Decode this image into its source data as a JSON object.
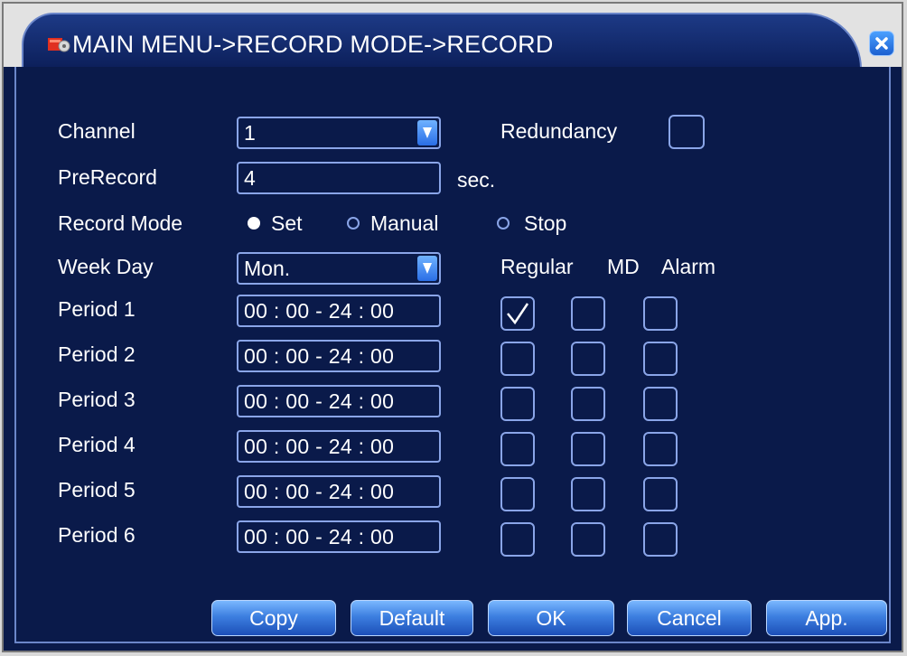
{
  "window": {
    "title": "MAIN MENU->RECORD MODE->RECORD"
  },
  "form": {
    "channel_label": "Channel",
    "channel_value": "1",
    "redundancy_label": "Redundancy",
    "prerecord_label": "PreRecord",
    "prerecord_value": "4",
    "prerecord_unit": "sec.",
    "record_mode_label": "Record Mode",
    "record_mode_options": [
      {
        "label": "Set",
        "selected": true
      },
      {
        "label": "Manual",
        "selected": false
      },
      {
        "label": "Stop",
        "selected": false
      }
    ],
    "weekday_label": "Week Day",
    "weekday_value": "Mon.",
    "columns": [
      "Regular",
      "MD",
      "Alarm"
    ],
    "periods": [
      {
        "label": "Period 1",
        "time": "00 : 00 - 24 : 00",
        "regular": true,
        "md": false,
        "alarm": false
      },
      {
        "label": "Period 2",
        "time": "00 : 00 - 24 : 00",
        "regular": false,
        "md": false,
        "alarm": false
      },
      {
        "label": "Period 3",
        "time": "00 : 00 - 24 : 00",
        "regular": false,
        "md": false,
        "alarm": false
      },
      {
        "label": "Period 4",
        "time": "00 : 00 - 24 : 00",
        "regular": false,
        "md": false,
        "alarm": false
      },
      {
        "label": "Period 5",
        "time": "00 : 00 - 24 : 00",
        "regular": false,
        "md": false,
        "alarm": false
      },
      {
        "label": "Period 6",
        "time": "00 : 00 - 24 : 00",
        "regular": false,
        "md": false,
        "alarm": false
      }
    ]
  },
  "buttons": {
    "copy": "Copy",
    "default": "Default",
    "ok": "OK",
    "cancel": "Cancel",
    "apply": "App."
  },
  "icons": {
    "title": "record-settings-icon",
    "close": "close-icon",
    "dropdown": "chevron-down-icon",
    "check": "checkmark-icon"
  },
  "colors": {
    "background": "#0a1a4a",
    "border": "#8aa5e8",
    "button": "#3d7fe0"
  }
}
